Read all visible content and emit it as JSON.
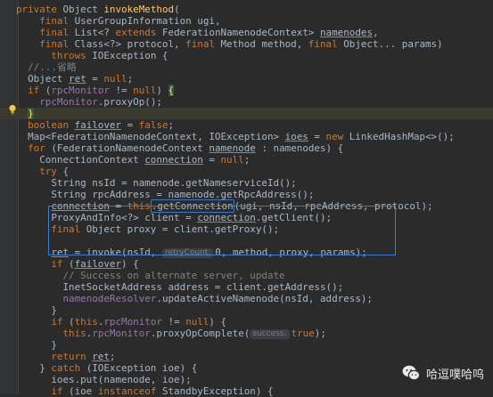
{
  "colors": {
    "background": "#2b2b2b",
    "keyword": "#cc7832",
    "method_decl": "#ffc66d",
    "field": "#9876aa",
    "comment": "#808080",
    "text": "#a9b7c6",
    "selection_box": "#3a7cd5"
  },
  "icons": [
    "lightbulb-icon",
    "wechat-icon"
  ],
  "watermark": {
    "text": "哈逗噗哈呜"
  },
  "code": {
    "lines": [
      [
        {
          "t": "private ",
          "c": "kw"
        },
        {
          "t": "Object ",
          "c": "tx"
        },
        {
          "t": "invokeMethod",
          "c": "fn"
        },
        {
          "t": "(",
          "c": "tx"
        }
      ],
      [
        {
          "t": "    final ",
          "c": "kw"
        },
        {
          "t": "UserGroupInformation ugi,",
          "c": "tx"
        }
      ],
      [
        {
          "t": "    final ",
          "c": "kw"
        },
        {
          "t": "List<? ",
          "c": "tx"
        },
        {
          "t": "extends ",
          "c": "kw"
        },
        {
          "t": "FederationNamenodeContext> ",
          "c": "tx"
        },
        {
          "t": "namenodes",
          "c": "ul"
        },
        {
          "t": ",",
          "c": "tx"
        }
      ],
      [
        {
          "t": "    final ",
          "c": "kw"
        },
        {
          "t": "Class<?> protocol, ",
          "c": "tx"
        },
        {
          "t": "final ",
          "c": "kw"
        },
        {
          "t": "Method method, ",
          "c": "tx"
        },
        {
          "t": "final ",
          "c": "kw"
        },
        {
          "t": "Object... params)",
          "c": "tx"
        }
      ],
      [
        {
          "t": "      throws ",
          "c": "kw"
        },
        {
          "t": "IOException {",
          "c": "tx"
        }
      ],
      [
        {
          "t": "  //...省略",
          "c": "cm"
        }
      ],
      [
        {
          "t": "  Object ",
          "c": "tx"
        },
        {
          "t": "ret",
          "c": "ul"
        },
        {
          "t": " = ",
          "c": "tx"
        },
        {
          "t": "null",
          "c": "kw"
        },
        {
          "t": ";",
          "c": "tx"
        }
      ],
      [
        {
          "t": "  if ",
          "c": "kw"
        },
        {
          "t": "(",
          "c": "tx"
        },
        {
          "t": "rpcMonitor",
          "c": "fld"
        },
        {
          "t": " != ",
          "c": "tx"
        },
        {
          "t": "null",
          "c": "kw"
        },
        {
          "t": ") ",
          "c": "tx"
        },
        {
          "t": "{",
          "c": "br"
        }
      ],
      [
        {
          "t": "    ",
          "c": "tx"
        },
        {
          "t": "rpcMonitor",
          "c": "fld"
        },
        {
          "t": ".proxyOp();",
          "c": "tx"
        }
      ],
      [
        {
          "t": "  ",
          "c": "tx"
        },
        {
          "t": "}",
          "c": "br"
        }
      ],
      [
        {
          "t": "  boolean ",
          "c": "kw"
        },
        {
          "t": "failover",
          "c": "ul"
        },
        {
          "t": " = ",
          "c": "tx"
        },
        {
          "t": "false",
          "c": "kw"
        },
        {
          "t": ";",
          "c": "tx"
        }
      ],
      [
        {
          "t": "  Map<FederationNamenodeContext, IOException> ",
          "c": "tx"
        },
        {
          "t": "ioes",
          "c": "ul"
        },
        {
          "t": " = ",
          "c": "tx"
        },
        {
          "t": "new ",
          "c": "kw"
        },
        {
          "t": "LinkedHashMap<>();",
          "c": "tx"
        }
      ],
      [
        {
          "t": "  for ",
          "c": "kw"
        },
        {
          "t": "(FederationNamenodeContext ",
          "c": "tx"
        },
        {
          "t": "namenode",
          "c": "ul"
        },
        {
          "t": " : namenodes) {",
          "c": "tx"
        }
      ],
      [
        {
          "t": "    ConnectionContext ",
          "c": "tx"
        },
        {
          "t": "connection",
          "c": "ul"
        },
        {
          "t": " = ",
          "c": "tx"
        },
        {
          "t": "null",
          "c": "kw"
        },
        {
          "t": ";",
          "c": "tx"
        }
      ],
      [
        {
          "t": "    try ",
          "c": "kw"
        },
        {
          "t": "{",
          "c": "tx"
        }
      ],
      [
        {
          "t": "      String nsId = namenode.getNameserviceId();",
          "c": "tx"
        }
      ],
      [
        {
          "t": "      String rpcAddress = namenode.getRpcAddress();",
          "c": "tx"
        }
      ],
      [
        {
          "t": "      ",
          "c": "tx"
        },
        {
          "t": "connection",
          "c": "ul"
        },
        {
          "t": " = ",
          "c": "tx"
        },
        {
          "t": "this",
          "c": "kw"
        },
        {
          "t": ".getConnection",
          "c": "mk"
        },
        {
          "t": "(ugi, nsId, rpcAddress, protocol);",
          "c": "tx"
        }
      ],
      [
        {
          "t": "      ProxyAndInfo<?> client = ",
          "c": "tx"
        },
        {
          "t": "connection",
          "c": "ul"
        },
        {
          "t": ".getClient();",
          "c": "tx"
        }
      ],
      [
        {
          "t": "      final ",
          "c": "kw"
        },
        {
          "t": "Object proxy = client.getProxy();",
          "c": "tx"
        }
      ],
      [
        {
          "t": "",
          "c": "tx"
        }
      ],
      [
        {
          "t": "      ",
          "c": "tx"
        },
        {
          "t": "ret",
          "c": "ul"
        },
        {
          "t": " = invoke(nsId, ",
          "c": "tx"
        },
        {
          "t": "retryCount:",
          "c": "hint"
        },
        {
          "t": "0, method, proxy, params);",
          "c": "tx"
        }
      ],
      [
        {
          "t": "      if ",
          "c": "kw"
        },
        {
          "t": "(",
          "c": "tx"
        },
        {
          "t": "failover",
          "c": "ul"
        },
        {
          "t": ") {",
          "c": "tx"
        }
      ],
      [
        {
          "t": "        // Success on alternate server, update",
          "c": "cm"
        }
      ],
      [
        {
          "t": "        InetSocketAddress address = client.getAddress();",
          "c": "tx"
        }
      ],
      [
        {
          "t": "        ",
          "c": "tx"
        },
        {
          "t": "namenodeResolver",
          "c": "fld"
        },
        {
          "t": ".updateActiveNamenode(nsId, address);",
          "c": "tx"
        }
      ],
      [
        {
          "t": "      }",
          "c": "tx"
        }
      ],
      [
        {
          "t": "      if ",
          "c": "kw"
        },
        {
          "t": "(",
          "c": "tx"
        },
        {
          "t": "this",
          "c": "kw"
        },
        {
          "t": ".",
          "c": "tx"
        },
        {
          "t": "rpcMonitor",
          "c": "fld"
        },
        {
          "t": " != ",
          "c": "tx"
        },
        {
          "t": "null",
          "c": "kw"
        },
        {
          "t": ") {",
          "c": "tx"
        }
      ],
      [
        {
          "t": "        ",
          "c": "tx"
        },
        {
          "t": "this",
          "c": "kw"
        },
        {
          "t": ".",
          "c": "tx"
        },
        {
          "t": "rpcMonitor",
          "c": "fld"
        },
        {
          "t": ".proxyOpComplete(",
          "c": "tx"
        },
        {
          "t": "success:",
          "c": "hint"
        },
        {
          "t": "true",
          "c": "kw"
        },
        {
          "t": ");",
          "c": "tx"
        }
      ],
      [
        {
          "t": "      }",
          "c": "tx"
        }
      ],
      [
        {
          "t": "      return ",
          "c": "kw"
        },
        {
          "t": "ret",
          "c": "ul"
        },
        {
          "t": ";",
          "c": "tx"
        }
      ],
      [
        {
          "t": "    } ",
          "c": "tx"
        },
        {
          "t": "catch ",
          "c": "kw"
        },
        {
          "t": "(IOException ioe) {",
          "c": "tx"
        }
      ],
      [
        {
          "t": "      ioes.put(namenode, ioe);",
          "c": "tx"
        }
      ],
      [
        {
          "t": "      if ",
          "c": "kw"
        },
        {
          "t": "(ioe ",
          "c": "tx"
        },
        {
          "t": "instanceof ",
          "c": "kw"
        },
        {
          "t": "StandbyException) {",
          "c": "tx"
        }
      ]
    ]
  }
}
